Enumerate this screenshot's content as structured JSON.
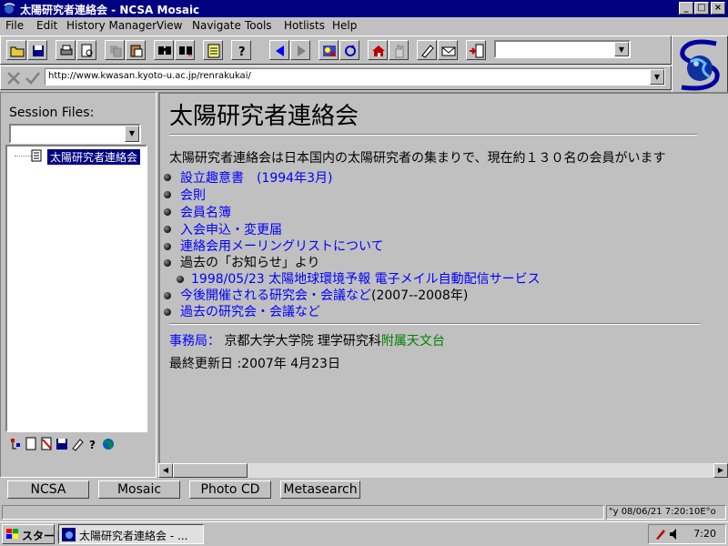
{
  "window": {
    "title": "太陽研究者連絡会 - NCSA Mosaic",
    "minimize": "_",
    "maximize": "□",
    "close": "×"
  },
  "menu": [
    "File",
    "Edit",
    "History Manager",
    "View",
    "Navigate",
    "Tools",
    "Hotlists",
    "Help"
  ],
  "address": {
    "url": "http://www.kwasan.kyoto-u.ac.jp/renrakukai/"
  },
  "sidebar": {
    "session_label": "Session Files:",
    "tree_item": "太陽研究者連絡会"
  },
  "page": {
    "heading": "太陽研究者連絡会",
    "intro": "太陽研究者連絡会は日本国内の太陽研究者の集まりで、現在約１３０名の会員がいます",
    "items": [
      {
        "text": "設立趣意書　(1994年3月)",
        "type": "link"
      },
      {
        "text": "会則",
        "type": "link"
      },
      {
        "text": "会員名簿",
        "type": "link"
      },
      {
        "text": "入会申込・変更届",
        "type": "link"
      },
      {
        "text": "連絡会用メーリングリストについて",
        "type": "link"
      }
    ],
    "notice_label": "過去の「お知らせ」より",
    "notice_sub": "1998/05/23 太陽地球環境予報 電子メイル自動配信サービス",
    "upcoming_link": "今後開催される研究会・会議など",
    "upcoming_suffix": "(2007--2008年)",
    "past_link": "過去の研究会・会議など",
    "office_label": "事務局：",
    "office_text": "京都大学大学院 理学研究科",
    "office_link": "附属天文台",
    "updated": "最終更新日 :2007年 4月23日"
  },
  "bottom_buttons": [
    "NCSA",
    "Mosaic",
    "Photo CD",
    "Metasearch"
  ],
  "status": {
    "datetime": "\"y 08/06/21 7:20:10E°o"
  },
  "taskbar": {
    "start": "スタート",
    "task": "太陽研究者連絡会 - ...",
    "clock": "7:20"
  },
  "colors": {
    "titlebar": "#000080",
    "link": "#0000ff",
    "green_link": "#008000",
    "face": "#c0c0c0"
  }
}
